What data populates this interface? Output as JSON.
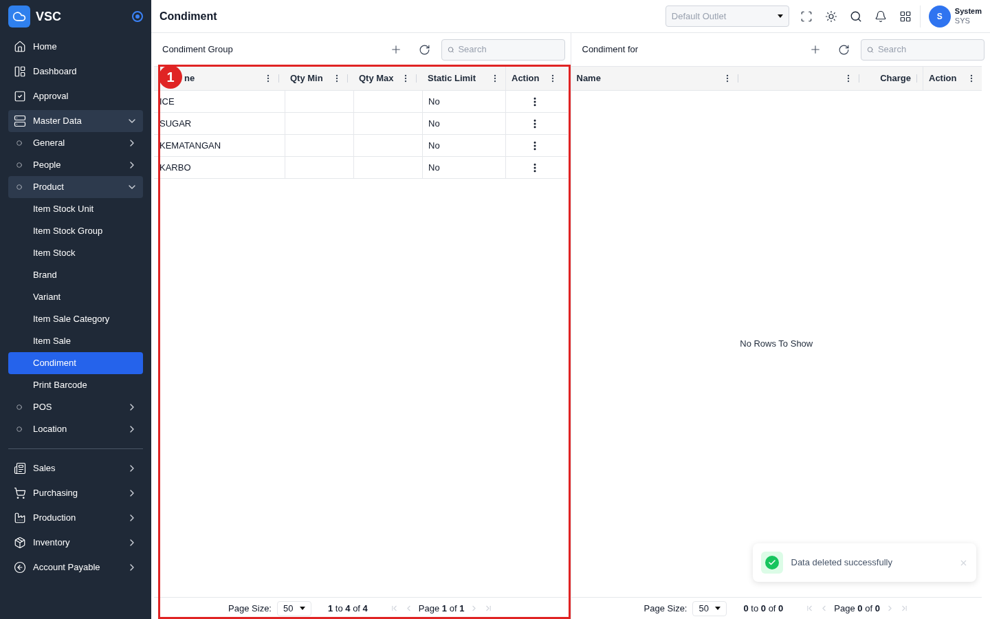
{
  "sidebar": {
    "brand": "VSC",
    "sections": [
      {
        "items": [
          {
            "label": "Home",
            "kind": "link",
            "selected": false
          },
          {
            "label": "Dashboard",
            "kind": "link",
            "selected": false
          },
          {
            "label": "Approval",
            "kind": "link",
            "selected": false
          },
          {
            "label": "Master Data",
            "kind": "group",
            "expanded": true,
            "children": [
              {
                "label": "General",
                "kind": "group",
                "expanded": false
              },
              {
                "label": "People",
                "kind": "group",
                "expanded": false
              },
              {
                "label": "Product",
                "kind": "group",
                "expanded": true,
                "children": [
                  {
                    "label": "Item Stock Unit",
                    "kind": "link",
                    "selected": false
                  },
                  {
                    "label": "Item Stock Group",
                    "kind": "link",
                    "selected": false
                  },
                  {
                    "label": "Item Stock",
                    "kind": "link",
                    "selected": false
                  },
                  {
                    "label": "Brand",
                    "kind": "link",
                    "selected": false
                  },
                  {
                    "label": "Variant",
                    "kind": "link",
                    "selected": false
                  },
                  {
                    "label": "Item Sale Category",
                    "kind": "link",
                    "selected": false
                  },
                  {
                    "label": "Item Sale",
                    "kind": "link",
                    "selected": false
                  },
                  {
                    "label": "Condiment",
                    "kind": "link",
                    "selected": true
                  },
                  {
                    "label": "Print Barcode",
                    "kind": "link",
                    "selected": false
                  }
                ]
              },
              {
                "label": "POS",
                "kind": "group",
                "expanded": false
              },
              {
                "label": "Location",
                "kind": "group",
                "expanded": false
              }
            ]
          }
        ]
      },
      {
        "items": [
          {
            "label": "Sales",
            "kind": "group",
            "expanded": false
          },
          {
            "label": "Purchasing",
            "kind": "group",
            "expanded": false
          },
          {
            "label": "Production",
            "kind": "group",
            "expanded": false
          },
          {
            "label": "Inventory",
            "kind": "group",
            "expanded": false
          },
          {
            "label": "Account Payable",
            "kind": "group",
            "expanded": false
          }
        ]
      }
    ]
  },
  "header": {
    "title": "Condiment",
    "outlet_select": {
      "placeholder": "Default Outlet"
    },
    "user": {
      "initial": "S",
      "name": "System",
      "code": "SYS"
    }
  },
  "panels": [
    {
      "title": "Condiment Group",
      "search": {
        "placeholder": "Search"
      },
      "columns": [
        {
          "label": "ne",
          "menu": true
        },
        {
          "label": "Qty Min",
          "menu": true
        },
        {
          "label": "Qty Max",
          "menu": true
        },
        {
          "label": "Static Limit",
          "menu": true
        },
        {
          "label": "Action",
          "menu": true
        }
      ],
      "rows": [
        {
          "name": "ICE",
          "static_limit": "No"
        },
        {
          "name": "SUGAR",
          "static_limit": "No"
        },
        {
          "name": "KEMATANGAN",
          "static_limit": "No"
        },
        {
          "name": "KARBO",
          "static_limit": "No"
        }
      ],
      "pagination": {
        "page_size_label": "Page Size:",
        "page_size": "50",
        "range": "**1** to **4** of **4**",
        "page": "Page **1** of **1**"
      },
      "annotation": {
        "label": "1"
      }
    },
    {
      "title": "Condiment for",
      "search": {
        "placeholder": "Search"
      },
      "columns": [
        {
          "label": "Name",
          "menu": true
        },
        {
          "menu": true
        },
        {
          "label": "Charge",
          "menu": false
        },
        {
          "label": "Action",
          "menu": true
        }
      ],
      "empty_message": "No Rows To Show",
      "pagination": {
        "page_size_label": "Page Size:",
        "page_size": "50",
        "range": "**0** to **0** of **0**",
        "page": "Page **0** of **0**"
      },
      "toast": {
        "message": "Data deleted successfully"
      }
    }
  ]
}
